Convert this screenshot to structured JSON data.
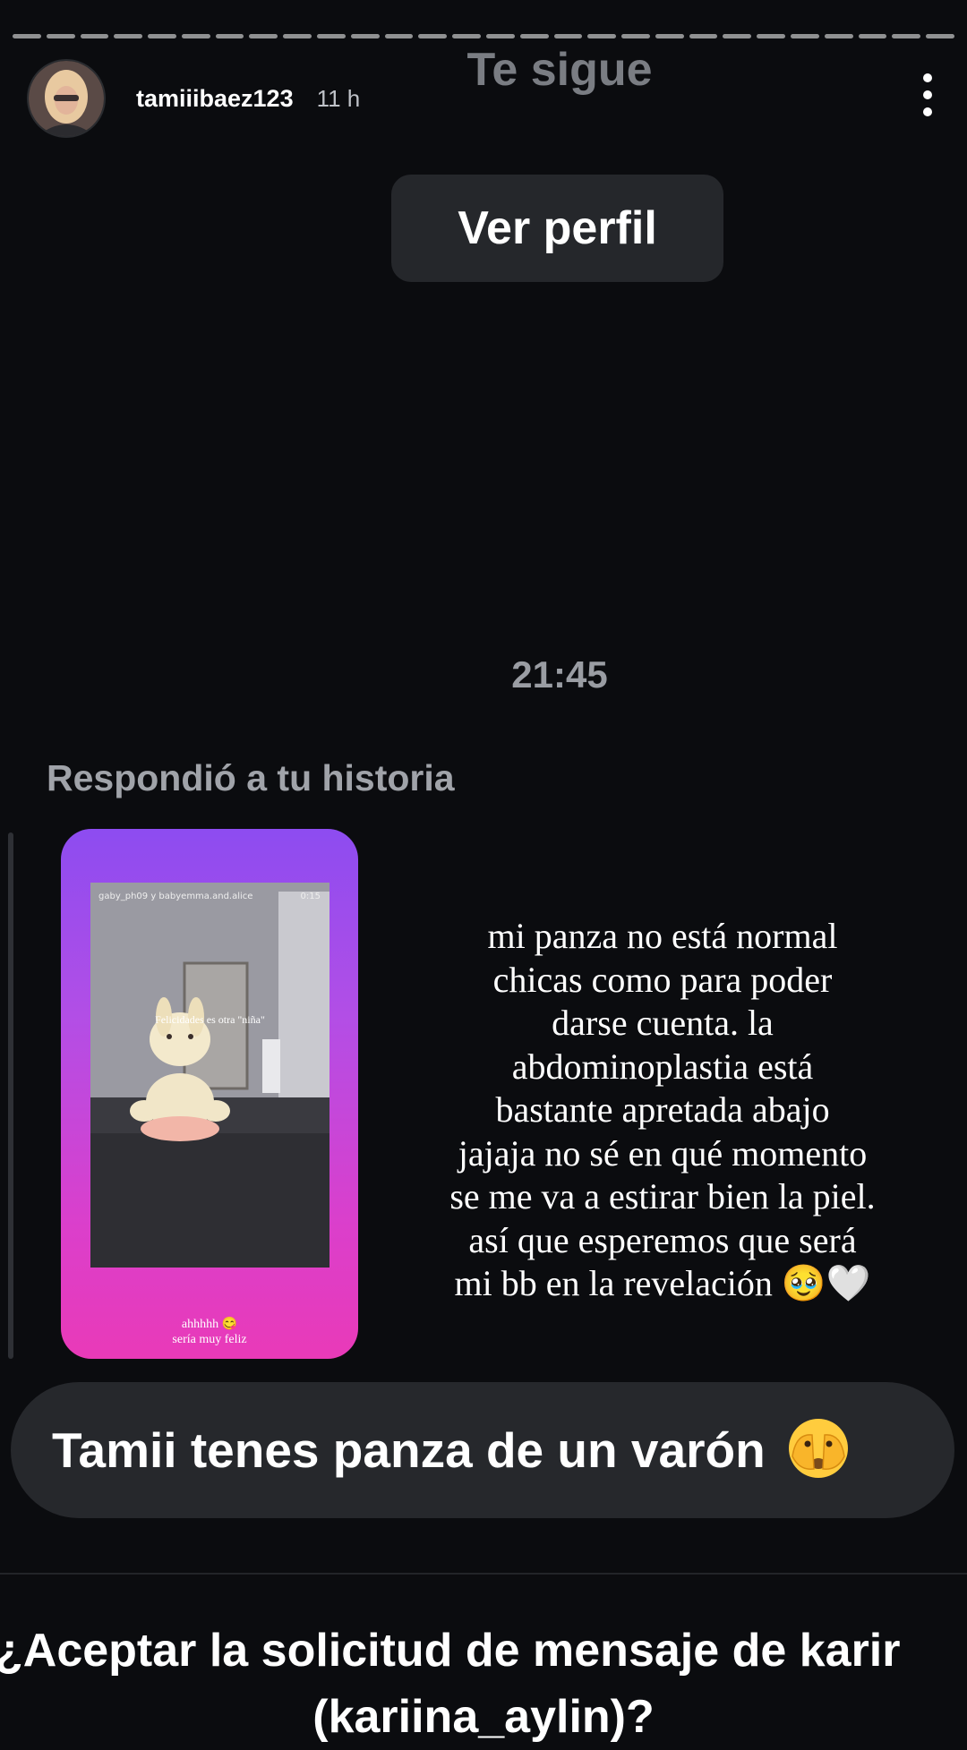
{
  "story": {
    "username": "tamiiibaez123",
    "time_ago": "11 h"
  },
  "dm": {
    "follows_label": "Te sigue",
    "view_profile_button": "Ver perfil",
    "timestamp": "21:45",
    "replied_label": "Respondió a tu historia",
    "story_card": {
      "accounts": "gaby_ph09 y babyemma.and.alice",
      "duration": "0:15",
      "caption": "Felicidades es otra \"niña\"",
      "bottom_line1": "ahhhhh 😋",
      "bottom_line2": "sería muy feliz"
    },
    "message": "Tamii tenes panza de un varón",
    "request_line1": "¿Aceptar la solicitud de mensaje de karir",
    "request_line2": "(kariina_aylin)?"
  },
  "story_text": {
    "lines": [
      "mi panza no está normal",
      "chicas como para poder",
      "darse cuenta. la",
      "abdominoplastia está",
      "bastante apretada abajo",
      "jajaja no sé en qué momento",
      "se me va a estirar bien la piel.",
      "así que esperemos que será",
      "mi bb en la revelación 🥹🤍"
    ]
  },
  "colors": {
    "background": "#0b0c0f",
    "bubble": "#26282c",
    "card_gradient_top": "#8d4cf0",
    "card_gradient_bottom": "#e93ab8"
  },
  "icons": [
    "more-options-icon",
    "face-with-peeking-eye-emoji"
  ]
}
